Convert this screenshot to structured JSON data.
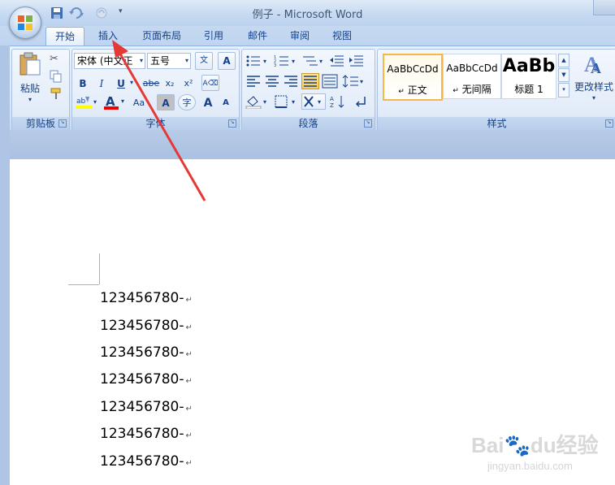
{
  "window": {
    "title": "例子 - Microsoft Word"
  },
  "tabs": [
    "开始",
    "插入",
    "页面布局",
    "引用",
    "邮件",
    "审阅",
    "视图"
  ],
  "clipboard": {
    "paste_label": "粘贴",
    "group_label": "剪贴板"
  },
  "font": {
    "font_name": "宋体 (中文正",
    "font_size": "五号",
    "group_label": "字体",
    "bold": "B",
    "italic": "I",
    "underline": "U",
    "strike": "abe",
    "subscript": "x₂",
    "superscript": "x²",
    "change_case": "Aa",
    "grow": "A",
    "shrink": "A",
    "font_color": "A",
    "char_shading": "A",
    "enclose": "字",
    "phonetic": "文",
    "clear_format": "A"
  },
  "paragraph": {
    "group_label": "段落"
  },
  "styles": {
    "group_label": "样式",
    "items": [
      {
        "sample": "AaBbCcDd",
        "name": "正文"
      },
      {
        "sample": "AaBbCcDd",
        "name": "无间隔"
      },
      {
        "sample": "AaBb",
        "name": "标题 1"
      }
    ],
    "change_styles_label": "更改样式"
  },
  "document": {
    "lines": [
      "123456780-",
      "123456780-",
      "123456780-",
      "123456780-",
      "123456780-",
      "123456780-",
      "123456780-"
    ],
    "paragraph_mark": "↵"
  },
  "watermark": {
    "brand": "Bai",
    "brand2": "du",
    "brand3": "经验",
    "url": "jingyan.baidu.com"
  },
  "colors": {
    "accent": "#15428b",
    "arrow": "#e53935",
    "ribbon": "#dbe7f6"
  }
}
